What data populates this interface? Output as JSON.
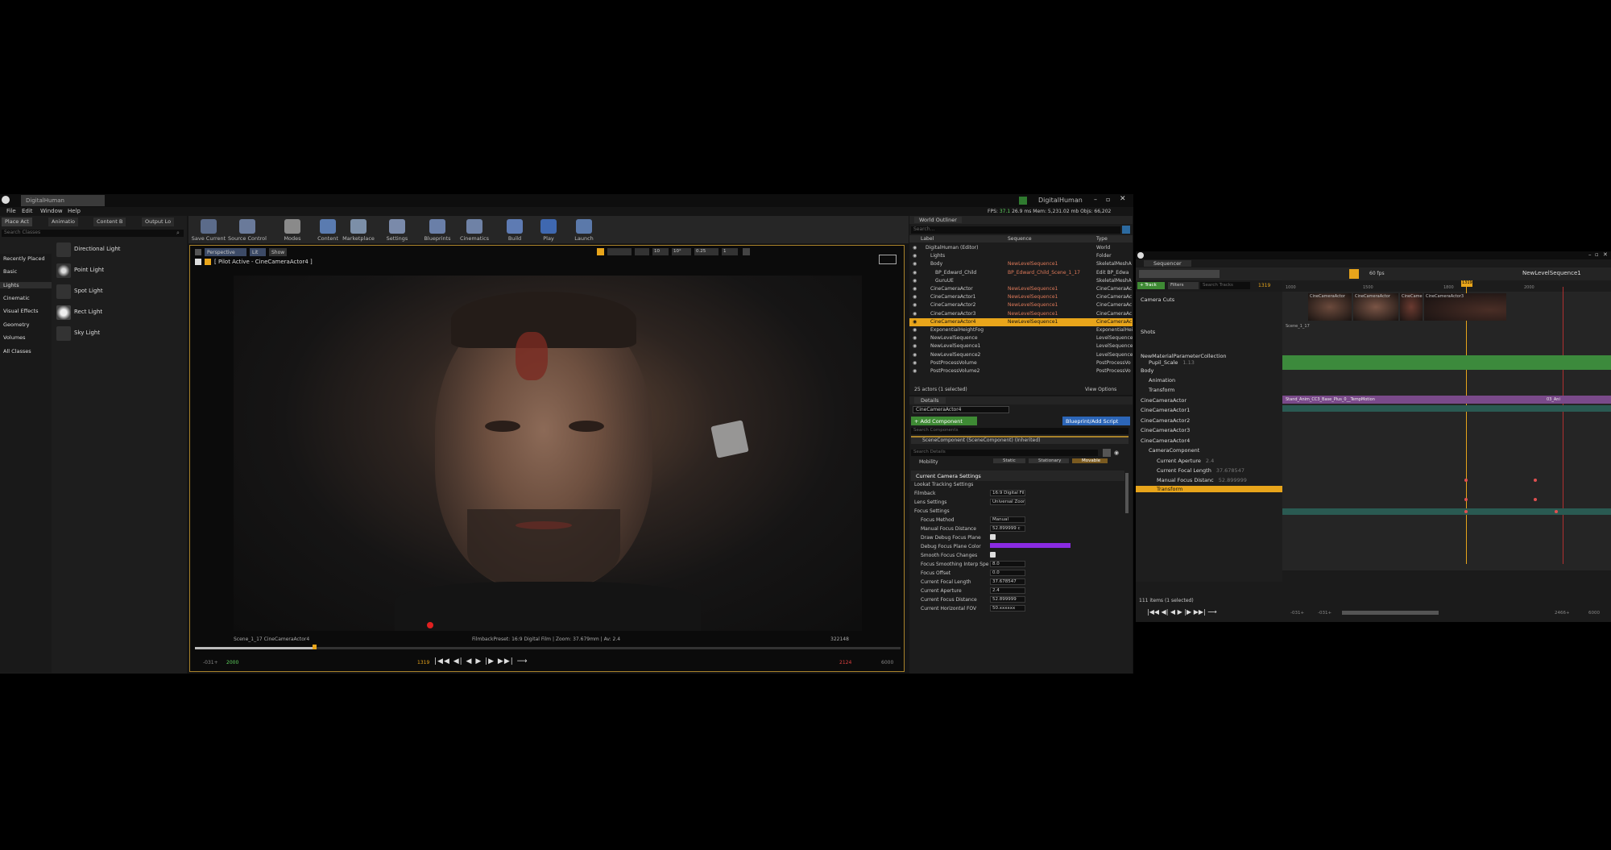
{
  "window": {
    "tab_title": "DigitalHuman",
    "project_name": "DigitalHuman",
    "stats": {
      "fps_label": "FPS:",
      "fps": "37.1",
      "ms": "26.9 ms",
      "mem": "Mem: 5,231.02 mb",
      "objs": "Objs: 66,202"
    }
  },
  "menu": [
    "File",
    "Edit",
    "Window",
    "Help"
  ],
  "modes_tabs": [
    "Place Act",
    "Animatio",
    "Content B",
    "Output Lo"
  ],
  "search_classes_placeholder": "Search Classes",
  "classes": [
    "Recently Placed",
    "Basic",
    "Lights",
    "Cinematic",
    "Visual Effects",
    "Geometry",
    "Volumes",
    "All Classes"
  ],
  "lights": [
    "Directional Light",
    "Point Light",
    "Spot Light",
    "Rect Light",
    "Sky Light"
  ],
  "toolbar": [
    "Save Current",
    "Source Control",
    "Modes",
    "Content",
    "Marketplace",
    "Settings",
    "Blueprints",
    "Cinematics",
    "Build",
    "Play",
    "Launch"
  ],
  "viewport": {
    "perspective": "Perspective",
    "lit": "Lit",
    "show": "Show",
    "pilot": "[ Pilot Active - CineCameraActor4 ]",
    "snap_vals": [
      "10",
      "10°",
      "0.25",
      "1"
    ],
    "shot_label": "Scene_1_17  CineCameraActor4",
    "filmback": "FilmbackPreset: 16:9 Digital Film | Zoom: 37.679mm | Av: 2.4",
    "frame_count": "322148",
    "timeline": {
      "start": "-031+",
      "start2": "2000",
      "current": "1319",
      "end2": "2124",
      "end": "6000"
    }
  },
  "outliner": {
    "title": "World Outliner",
    "search_placeholder": "Search...",
    "cols": [
      "Label",
      "Sequence",
      "Type"
    ],
    "rows": [
      {
        "label": "DigitalHuman (Editor)",
        "seq": "",
        "type": "World",
        "indent": 0
      },
      {
        "label": "Lights",
        "seq": "",
        "type": "Folder",
        "indent": 1
      },
      {
        "label": "Body",
        "seq": "NewLevelSequence1",
        "type": "SkeletalMeshA",
        "indent": 1
      },
      {
        "label": "BP_Edward_Child",
        "seq": "BP_Edward_Child_Scene_1_17",
        "type": "Edit BP_Edwa",
        "indent": 2
      },
      {
        "label": "GuruUE",
        "seq": "",
        "type": "SkeletalMeshA",
        "indent": 2
      },
      {
        "label": "CineCameraActor",
        "seq": "NewLevelSequence1",
        "type": "CineCameraAc",
        "indent": 1
      },
      {
        "label": "CineCameraActor1",
        "seq": "NewLevelSequence1",
        "type": "CineCameraAc",
        "indent": 1
      },
      {
        "label": "CineCameraActor2",
        "seq": "NewLevelSequence1",
        "type": "CineCameraAc",
        "indent": 1
      },
      {
        "label": "CineCameraActor3",
        "seq": "NewLevelSequence1",
        "type": "CineCameraAc",
        "indent": 1
      },
      {
        "label": "CineCameraActor4",
        "seq": "NewLevelSequence1",
        "type": "CineCameraAc",
        "indent": 1
      },
      {
        "label": "ExponentialHeightFog",
        "seq": "",
        "type": "ExponentialHei",
        "indent": 1
      },
      {
        "label": "NewLevelSequence",
        "seq": "",
        "type": "LevelSequence",
        "indent": 1
      },
      {
        "label": "NewLevelSequence1",
        "seq": "",
        "type": "LevelSequence",
        "indent": 1
      },
      {
        "label": "NewLevelSequence2",
        "seq": "",
        "type": "LevelSequence",
        "indent": 1
      },
      {
        "label": "PostProcessVolume",
        "seq": "",
        "type": "PostProcessVo",
        "indent": 1
      },
      {
        "label": "PostProcessVolume2",
        "seq": "",
        "type": "PostProcessVo",
        "indent": 1
      }
    ],
    "selected_index": 9,
    "count": "25 actors (1 selected)",
    "view_options": "View Options"
  },
  "details": {
    "title": "Details",
    "actor_name": "CineCameraActor4",
    "add_component": "+ Add Component",
    "blueprint_script": "Blueprint/Add Script",
    "search_components": "Search Components",
    "component": "SceneComponent (SceneComponent) (Inherited)",
    "search_details": "Search Details",
    "mobility_label": "Mobility",
    "mobility_opts": [
      "Static",
      "Stationary",
      "Movable"
    ],
    "section": "Current Camera Settings",
    "props": [
      {
        "label": "Lookat Tracking Settings",
        "value": ""
      },
      {
        "label": "Filmback",
        "value": "16:9 Digital Film"
      },
      {
        "label": "Lens Settings",
        "value": "Universal Zoom"
      },
      {
        "label": "Focus Settings",
        "value": ""
      },
      {
        "label": "Focus Method",
        "value": "Manual"
      },
      {
        "label": "Manual Focus Distance",
        "value": "52.899999 c"
      },
      {
        "label": "Draw Debug Focus Plane",
        "value": ""
      },
      {
        "label": "Debug Focus Plane Color",
        "value": ""
      },
      {
        "label": "Smooth Focus Changes",
        "value": ""
      },
      {
        "label": "Focus Smoothing Interp Spe",
        "value": "8.0"
      },
      {
        "label": "Focus Offset",
        "value": "0.0"
      },
      {
        "label": "Current Focal Length",
        "value": "37.678547"
      },
      {
        "label": "Current Aperture",
        "value": "2.4"
      },
      {
        "label": "Current Focus Distance",
        "value": "52.899999"
      },
      {
        "label": "Current Horizontal FOV",
        "value": "50.xxxxxx"
      }
    ]
  },
  "sequencer": {
    "tab": "Sequencer",
    "track_btn": "+ Track",
    "filters": "Filters",
    "search_tracks": "Search Tracks",
    "frame": "1319",
    "fps": "60 fps",
    "sequence_name": "NewLevelSequence1",
    "playhead": "1319",
    "ruler": [
      "1000",
      "1500",
      "1800",
      "2000"
    ],
    "tracks": [
      {
        "label": "Camera Cuts",
        "indent": 0
      },
      {
        "label": "Shots",
        "indent": 0
      },
      {
        "label": "NewMaterialParameterCollection",
        "indent": 0
      },
      {
        "label": "Pupil_Scale",
        "value": "1.13",
        "indent": 1
      },
      {
        "label": "Body",
        "indent": 0
      },
      {
        "label": "Animation",
        "indent": 1
      },
      {
        "label": "Transform",
        "indent": 1
      },
      {
        "label": "CineCameraActor",
        "indent": 0
      },
      {
        "label": "CineCameraActor1",
        "indent": 0
      },
      {
        "label": "CineCameraActor2",
        "indent": 0
      },
      {
        "label": "CineCameraActor3",
        "indent": 0
      },
      {
        "label": "CineCameraActor4",
        "indent": 0
      },
      {
        "label": "CameraComponent",
        "indent": 1
      },
      {
        "label": "Current Aperture",
        "value": "2.4",
        "indent": 2
      },
      {
        "label": "Current Focal Length",
        "value": "37.678547",
        "indent": 2
      },
      {
        "label": "Manual Focus Distanc",
        "value": "52.899999",
        "indent": 2
      },
      {
        "label": "Transform",
        "indent": 1
      }
    ],
    "shot_thumbs": [
      "CineCameraActor",
      "CineCameraActor",
      "CineCame",
      "CineCameraActor3"
    ],
    "scene_label": "Scene_1_17",
    "anim_clip": "Stand_Anim_CC3_Base_Plus_0__TempMotion",
    "anim_clip2": "03_Ani",
    "items_count": "111 items (1 selected)",
    "bottom": {
      "start": "-031+",
      "start2": "-031+",
      "end2": "2466+",
      "end": "6000"
    }
  },
  "colors": {
    "accent": "#e8a51b",
    "selection": "#e8a51b",
    "green_track": "#3c8a3c",
    "purple_track": "#7a4a8a",
    "debug_purple": "#8a2be2"
  }
}
